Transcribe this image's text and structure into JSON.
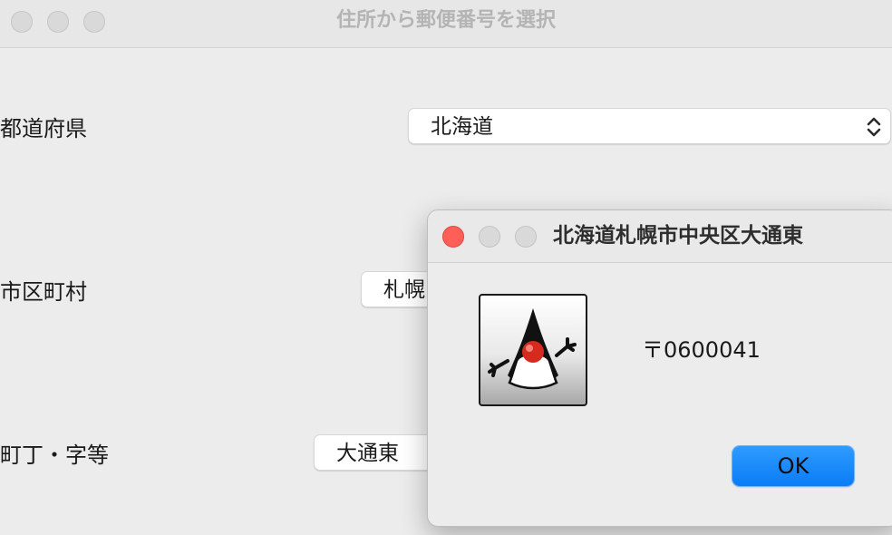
{
  "main_window": {
    "title": "住所から郵便番号を選択",
    "fields": [
      {
        "label": "都道府県",
        "value": "北海道"
      },
      {
        "label": "市区町村",
        "value": "札幌"
      },
      {
        "label": "町丁・字等",
        "value": "大通東"
      }
    ]
  },
  "dialog": {
    "title": "北海道札幌市中央区大通東",
    "message": "〒0600041",
    "ok_label": "OK",
    "icon": "java-duke-icon"
  },
  "colors": {
    "close_red": "#fe5f57",
    "ok_blue": "#0a7cf5",
    "inactive_traffic": "#d9d9d9"
  }
}
